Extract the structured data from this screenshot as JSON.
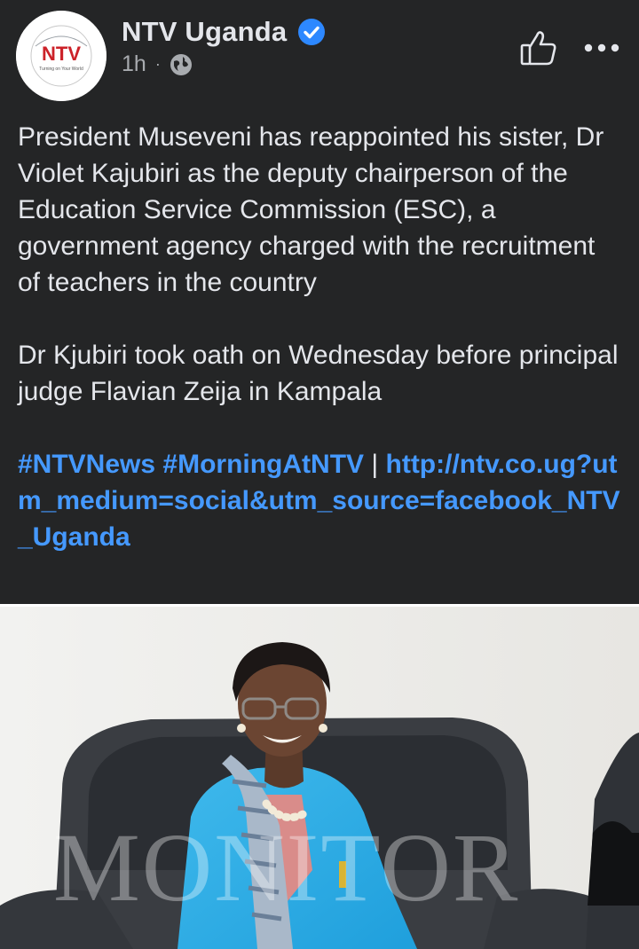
{
  "post": {
    "page_name": "NTV Uganda",
    "logo_text": "NTV",
    "logo_tagline": "Turning on Your World",
    "time_ago": "1h",
    "separator": "·",
    "icons": {
      "verified": "verified-badge-icon",
      "audience": "globe-icon",
      "like": "thumbs-up-icon",
      "more": "more-options-icon"
    },
    "colors": {
      "background": "#242526",
      "text": "#e4e6eb",
      "link": "#4599ff",
      "verified": "#2d88ff"
    },
    "paragraphs": [
      "President Museveni has reappointed his sister, Dr Violet Kajubiri as the deputy chairperson of the Education Service Commission (ESC), a government agency charged with the recruitment of teachers in the country",
      "Dr Kjubiri took oath on Wednesday before principal judge Flavian Zeija in Kampala"
    ],
    "hashtags": "#NTVNews #MorningAtNTV",
    "link_separator": " | ",
    "link": "http://ntv.co.ug?utm_medium=social&utm_source=facebook_NTV_Uganda",
    "photo_watermark": "MONITOR"
  }
}
